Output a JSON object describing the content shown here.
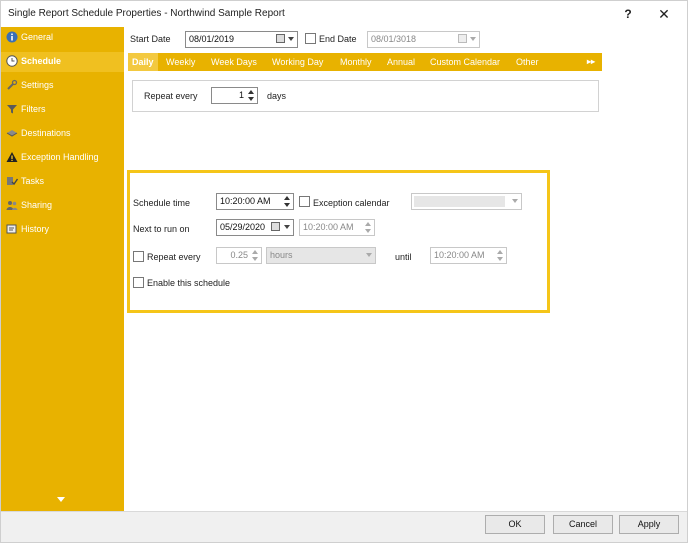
{
  "window": {
    "title": "Single Report Schedule Properties - Northwind Sample Report",
    "help_label": "?",
    "close_label": "✕"
  },
  "sidebar": {
    "items": [
      {
        "label": "General",
        "icon": "info-icon"
      },
      {
        "label": "Schedule",
        "icon": "clock-icon",
        "active": true
      },
      {
        "label": "Settings",
        "icon": "wrench-icon"
      },
      {
        "label": "Filters",
        "icon": "filter-icon"
      },
      {
        "label": "Destinations",
        "icon": "destination-icon"
      },
      {
        "label": "Exception Handling",
        "icon": "warning-icon"
      },
      {
        "label": "Tasks",
        "icon": "tasks-icon"
      },
      {
        "label": "Sharing",
        "icon": "sharing-icon"
      },
      {
        "label": "History",
        "icon": "history-icon"
      }
    ],
    "scroll_icon": "chevron-down-icon"
  },
  "dates": {
    "start_label": "Start Date",
    "start_value": "08/01/2019",
    "end_label": "End Date",
    "end_value": "08/01/3018",
    "end_checked": false
  },
  "tabs": {
    "items": [
      "Daily",
      "Weekly",
      "Week Days",
      "Working Day",
      "Monthly",
      "Annual",
      "Custom Calendar",
      "Other"
    ],
    "active_index": 0,
    "more_label": "▸▸"
  },
  "daily": {
    "repeat_label": "Repeat every",
    "repeat_value": "1",
    "unit_label": "days"
  },
  "schedule": {
    "time_label": "Schedule time",
    "time_value": "10:20:00 AM",
    "exception_label": "Exception calendar",
    "exception_checked": false,
    "exception_value": "",
    "next_label": "Next to run on",
    "next_date": "05/29/2020",
    "next_time": "10:20:00 AM",
    "repeat_label": "Repeat every",
    "repeat_checked": false,
    "repeat_value": "0.25",
    "repeat_unit": "hours",
    "until_label": "until",
    "until_value": "10:20:00 AM",
    "enable_label": "Enable this schedule",
    "enable_checked": false
  },
  "footer": {
    "ok": "OK",
    "cancel": "Cancel",
    "apply": "Apply"
  },
  "colors": {
    "sidebar": "#e8b200",
    "active_item": "#f0c020",
    "highlight_border": "#f5c518"
  }
}
